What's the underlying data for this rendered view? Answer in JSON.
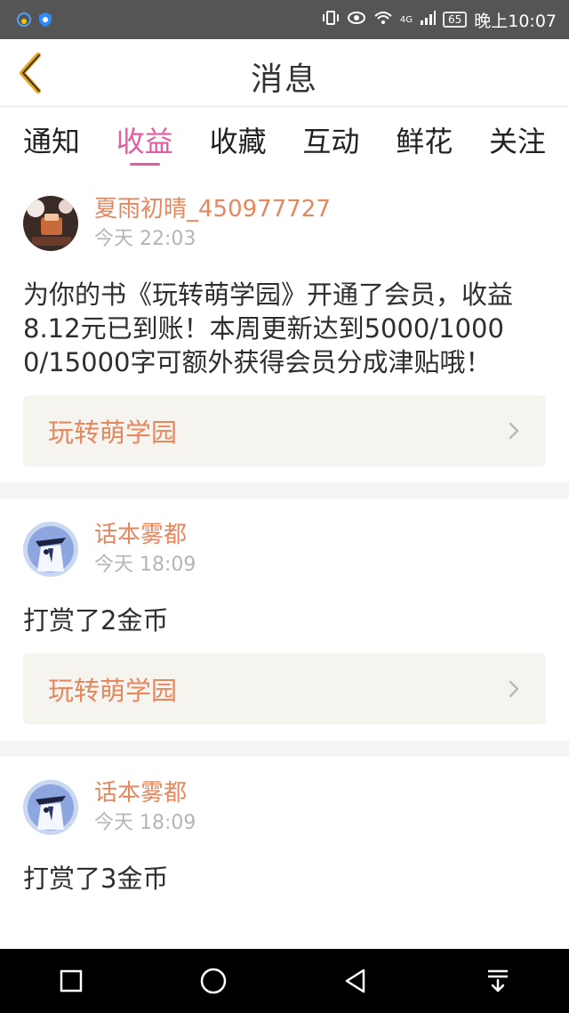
{
  "status_bar": {
    "battery": "65",
    "network": "4G",
    "time": "晚上10:07"
  },
  "header": {
    "title": "消息",
    "back_icon": "chevron-left-icon",
    "accent_color": "#e8a317"
  },
  "tabs": [
    {
      "label": "通知",
      "active": false
    },
    {
      "label": "收益",
      "active": true
    },
    {
      "label": "收藏",
      "active": false
    },
    {
      "label": "互动",
      "active": false
    },
    {
      "label": "鲜花",
      "active": false
    },
    {
      "label": "关注",
      "active": false
    }
  ],
  "colors": {
    "active_tab": "#e45ca0",
    "username": "#e5875f",
    "book_title": "#e5875f"
  },
  "messages": [
    {
      "user": "夏雨初晴_450977727",
      "time": "今天 22:03",
      "text": "为你的书《玩转萌学园》开通了会员，收益8.12元已到账！本周更新达到5000/10000/15000字可额外获得会员分成津贴哦！",
      "book": "玩转萌学园"
    },
    {
      "user": "话本雾都",
      "time": "今天 18:09",
      "text": "打赏了2金币",
      "book": "玩转萌学园"
    },
    {
      "user": "话本雾都",
      "time": "今天 18:09",
      "text": "打赏了3金币"
    }
  ]
}
